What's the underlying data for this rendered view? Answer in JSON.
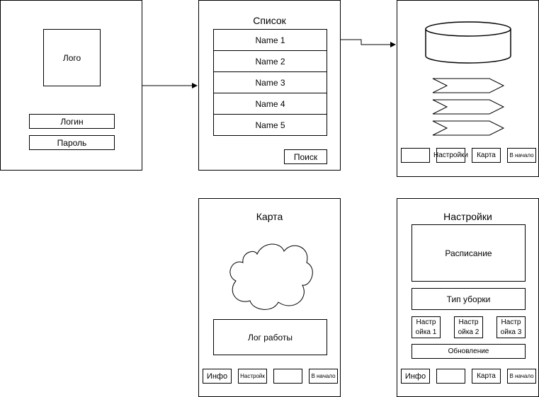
{
  "login_screen": {
    "logo": "Лого",
    "login_field": "Логин",
    "password_field": "Пароль"
  },
  "list_screen": {
    "title": "Список",
    "items": [
      "Name 1",
      "Name 2",
      "Name 3",
      "Name 4",
      "Name 5"
    ],
    "search_button": "Поиск"
  },
  "detail_screen": {
    "nav": {
      "settings": "Настройки",
      "map": "Карта",
      "home": "В начало"
    }
  },
  "map_screen": {
    "title": "Карта",
    "log": "Лог работы",
    "nav": {
      "info": "Инфо",
      "settings": "Настройк",
      "home": "В начало"
    }
  },
  "settings_screen": {
    "title": "Настройки",
    "schedule": "Расписание",
    "cleaning_type": "Тип уборки",
    "setting_1": "Настр ойка 1",
    "setting_2": "Настр ойка 2",
    "setting_3": "Настр ойка 3",
    "update": "Обновление",
    "nav": {
      "info": "Инфо",
      "map": "Карта",
      "home": "В начало"
    }
  }
}
